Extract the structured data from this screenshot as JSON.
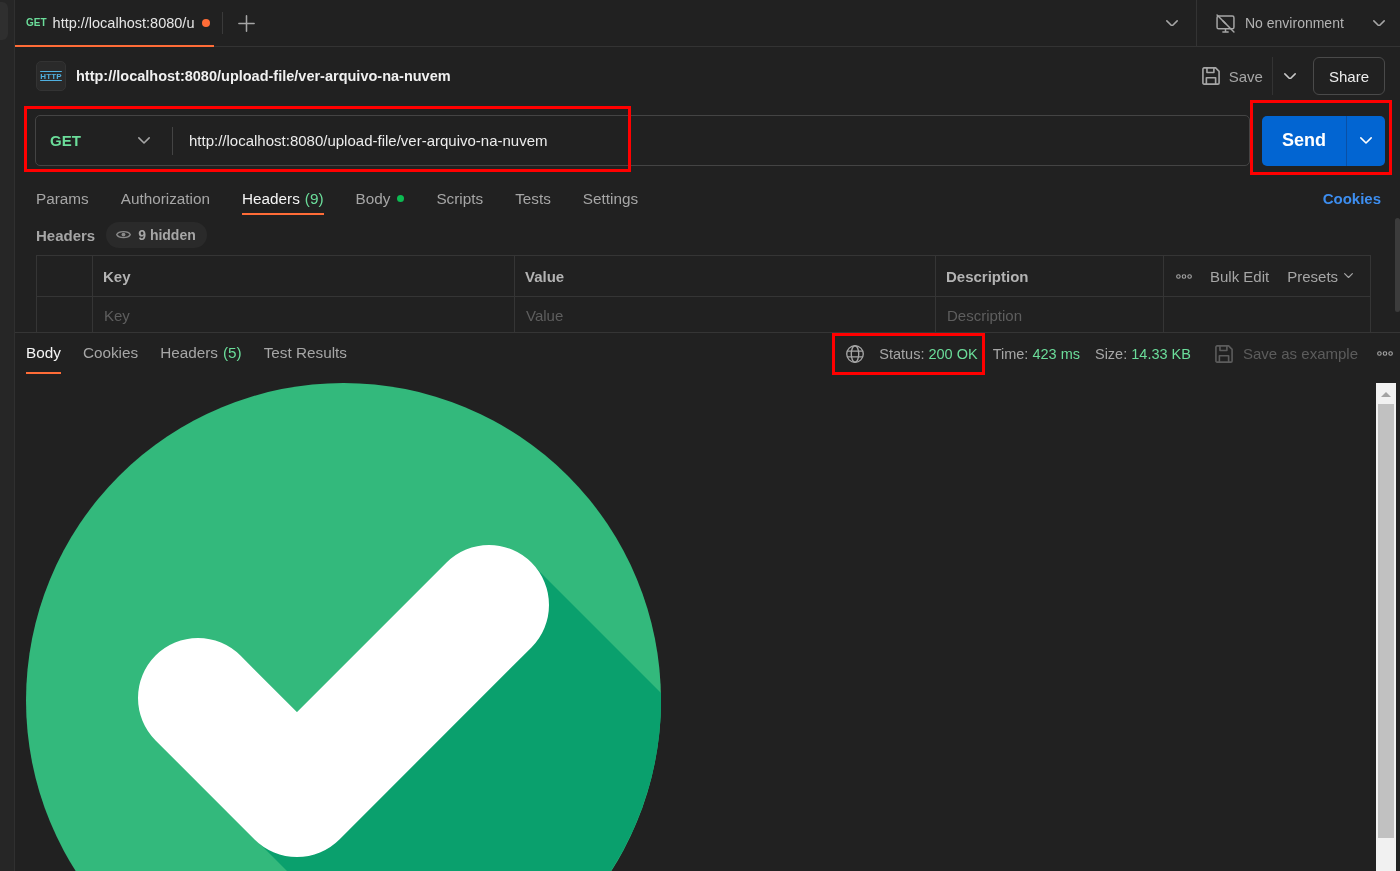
{
  "tab_bar": {
    "tabs": [
      {
        "method": "GET",
        "title": "http://localhost:8080/u",
        "unsaved": true,
        "selected": true
      }
    ],
    "environment": {
      "label": "No environment"
    }
  },
  "request": {
    "protocol_badge": "HTTP",
    "title": "http://localhost:8080/upload-file/ver-arquivo-na-nuvem",
    "save_label": "Save",
    "share_label": "Share",
    "method": "GET",
    "url": "http://localhost:8080/upload-file/ver-arquivo-na-nuvem",
    "send_label": "Send",
    "url_highlighted": true,
    "send_highlighted": true
  },
  "request_tabs": {
    "tabs": [
      {
        "label": "Params",
        "selected": false,
        "dot": false
      },
      {
        "label": "Authorization",
        "selected": false,
        "dot": false
      },
      {
        "label": "Headers",
        "count": "(9)",
        "selected": true,
        "dot": false
      },
      {
        "label": "Body",
        "selected": false,
        "dot": true
      },
      {
        "label": "Scripts",
        "selected": false,
        "dot": false
      },
      {
        "label": "Tests",
        "selected": false,
        "dot": false
      },
      {
        "label": "Settings",
        "selected": false,
        "dot": false
      }
    ],
    "cookies_link": "Cookies"
  },
  "headers": {
    "title": "Headers",
    "hidden_label": "9 hidden",
    "table": {
      "columns": [
        "Key",
        "Value",
        "Description"
      ],
      "actions": [
        "Bulk Edit",
        "Presets"
      ],
      "new_row": [
        {
          "placeholder": "Key"
        },
        {
          "placeholder": "Value"
        },
        {
          "placeholder": "Description"
        }
      ]
    }
  },
  "response": {
    "tabs": [
      {
        "label": "Body",
        "selected": true
      },
      {
        "label": "Cookies",
        "selected": false
      },
      {
        "label": "Headers",
        "count": "(5)",
        "selected": false
      },
      {
        "label": "Test Results",
        "selected": false
      }
    ],
    "status": {
      "label": "Status:",
      "value": "200 OK",
      "highlighted": true
    },
    "time": {
      "label": "Time:",
      "value": "423 ms"
    },
    "size": {
      "label": "Size:",
      "value": "14.33 KB"
    },
    "save_example": {
      "label": "Save as example",
      "disabled": true
    }
  }
}
